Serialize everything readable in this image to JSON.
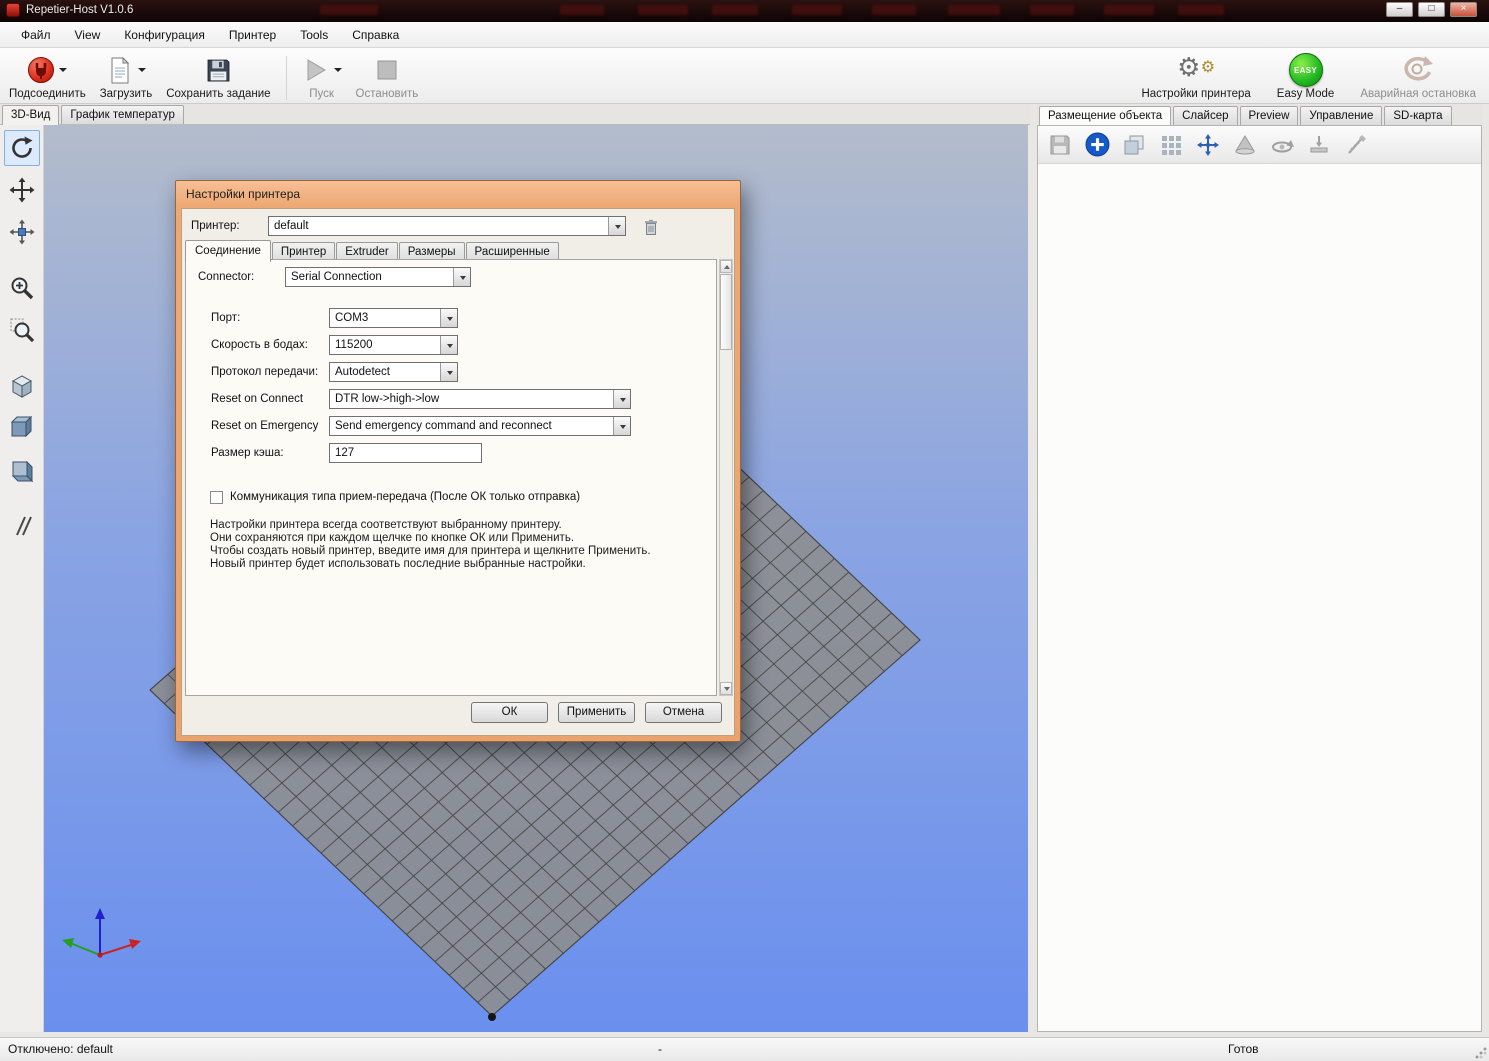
{
  "app": {
    "title": "Repetier-Host V1.0.6"
  },
  "window_controls": {
    "minimize": "–",
    "maximize": "□",
    "close": "×"
  },
  "menu": {
    "items": [
      "Файл",
      "View",
      "Конфигурация",
      "Принтер",
      "Tools",
      "Справка"
    ]
  },
  "toolbar": {
    "connect": "Подсоединить",
    "load": "Загрузить",
    "save_job": "Сохранить задание",
    "start": "Пуск",
    "stop": "Остановить",
    "printer_settings": "Настройки принтера",
    "easy_mode": "Easy Mode",
    "easy_badge": "EASY",
    "emergency_stop": "Аварийная остановка"
  },
  "view_tabs": {
    "view3d": "3D-Вид",
    "temp_graph": "График температур"
  },
  "right_panel": {
    "tabs": [
      "Размещение объекта",
      "Слайсер",
      "Preview",
      "Управление",
      "SD-карта"
    ]
  },
  "dialog": {
    "title": "Настройки принтера",
    "printer_label": "Принтер:",
    "printer_value": "default",
    "tabs": [
      "Соединение",
      "Принтер",
      "Extruder",
      "Размеры",
      "Расширенные"
    ],
    "connector_label": "Connector:",
    "connector_value": "Serial Connection",
    "port_label": "Порт:",
    "port_value": "COM3",
    "baud_label": "Скорость в бодах:",
    "baud_value": "115200",
    "protocol_label": "Протокол передачи:",
    "protocol_value": "Autodetect",
    "reset_connect_label": "Reset on Connect",
    "reset_connect_value": "DTR low->high->low",
    "reset_emergency_label": "Reset on Emergency",
    "reset_emergency_value": "Send emergency command and reconnect",
    "cache_label": "Размер кэша:",
    "cache_value": "127",
    "checkbox_label": "Коммуникация типа прием-передача (После ОК только отправка)",
    "info_lines": [
      "Настройки принтера всегда соответствуют выбранному принтеру.",
      "Они сохраняются при каждом щелчке по кнопке ОК или Применить.",
      "Чтобы создать новый принтер, введите имя для принтера и щелкните Применить.",
      "Новый принтер будет использовать последние выбранные настройки."
    ],
    "ok": "ОК",
    "apply": "Применить",
    "cancel": "Отмена"
  },
  "statusbar": {
    "connection": "Отключено: default",
    "center": "-",
    "state": "Готов"
  },
  "colors": {
    "accent_blue": "#1659c8",
    "easy_green": "#22b822",
    "connect_red": "#d92a18",
    "dialog_chrome": "#eca46e"
  }
}
